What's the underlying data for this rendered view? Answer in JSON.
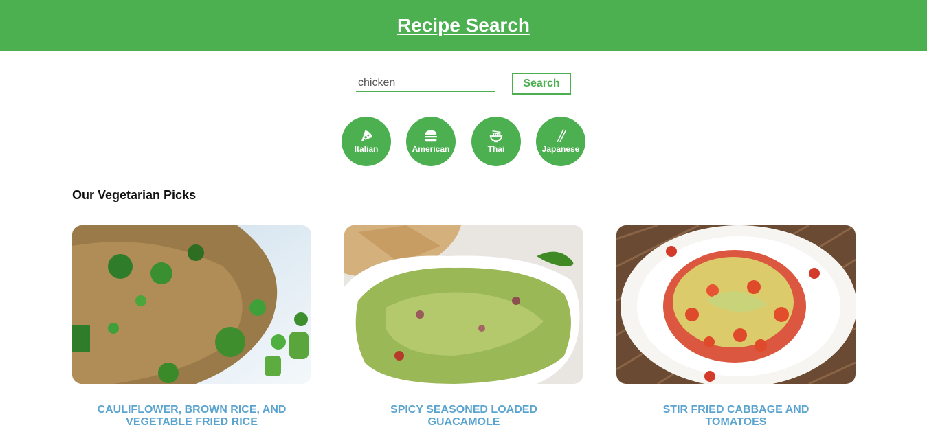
{
  "header": {
    "title": "Recipe Search"
  },
  "search": {
    "value": "chicken",
    "button_label": "Search"
  },
  "cuisines": [
    {
      "label": "Italian",
      "icon": "pizza-icon"
    },
    {
      "label": "American",
      "icon": "burger-icon"
    },
    {
      "label": "Thai",
      "icon": "noodle-bowl-icon"
    },
    {
      "label": "Japanese",
      "icon": "chopsticks-icon"
    }
  ],
  "section": {
    "title": "Our Vegetarian Picks"
  },
  "recipes": [
    {
      "title": "Cauliflower, Brown Rice, and Vegetable Fried Rice",
      "image": "fried-rice-photo"
    },
    {
      "title": "Spicy Seasoned Loaded Guacamole",
      "image": "guacamole-photo"
    },
    {
      "title": "Stir Fried Cabbage and Tomatoes",
      "image": "cabbage-tomato-photo"
    }
  ],
  "colors": {
    "brand": "#4caf50",
    "link": "#5ba4cf"
  }
}
